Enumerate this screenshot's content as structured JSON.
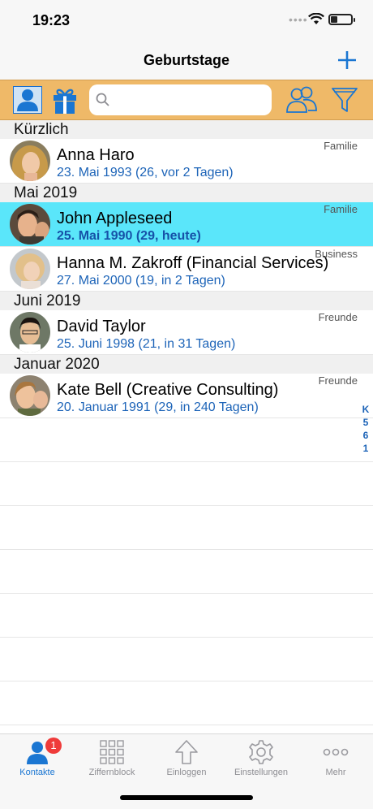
{
  "status": {
    "time": "19:23"
  },
  "nav": {
    "title": "Geburtstage",
    "add_icon": "plus-icon"
  },
  "toolbar": {
    "contacts_icon": "person-icon",
    "gift_icon": "gift-icon",
    "search_placeholder": "",
    "groups_icon": "group-icon",
    "filter_icon": "filter-icon"
  },
  "sections": [
    {
      "title": "Kürzlich",
      "rows": [
        {
          "name": "Anna Haro",
          "date": "23. Mai 1993 (26, vor 2 Tagen)",
          "group": "Familie"
        }
      ]
    },
    {
      "title": "Mai 2019",
      "rows": [
        {
          "name": "John Appleseed",
          "date": "25. Mai 1990 (29, heute)",
          "group": "Familie"
        },
        {
          "name": "Hanna M. Zakroff (Financial Services)",
          "date": "27. Mai 2000 (19, in 2 Tagen)",
          "group": "Business"
        }
      ]
    },
    {
      "title": "Juni 2019",
      "rows": [
        {
          "name": "David Taylor",
          "date": "25. Juni 1998 (21, in 31 Tagen)",
          "group": "Freunde"
        }
      ]
    },
    {
      "title": "Januar 2020",
      "rows": [
        {
          "name": "Kate Bell (Creative Consulting)",
          "date": "20. Januar 1991 (29, in 240 Tagen)",
          "group": "Freunde"
        }
      ]
    }
  ],
  "index": [
    "K",
    "5",
    "6",
    "1"
  ],
  "tabbar": {
    "tabs": [
      {
        "label": "Kontakte",
        "icon": "person-icon",
        "badge": "1"
      },
      {
        "label": "Ziffernblock",
        "icon": "keypad-icon"
      },
      {
        "label": "Einloggen",
        "icon": "upload-arrow-icon"
      },
      {
        "label": "Einstellungen",
        "icon": "gear-icon"
      },
      {
        "label": "Mehr",
        "icon": "more-dots-icon"
      }
    ]
  },
  "colors": {
    "accent": "#1a76d2",
    "toolbar": "#efb968",
    "highlight": "#5ae6fa",
    "badge": "#ef3b3a"
  }
}
